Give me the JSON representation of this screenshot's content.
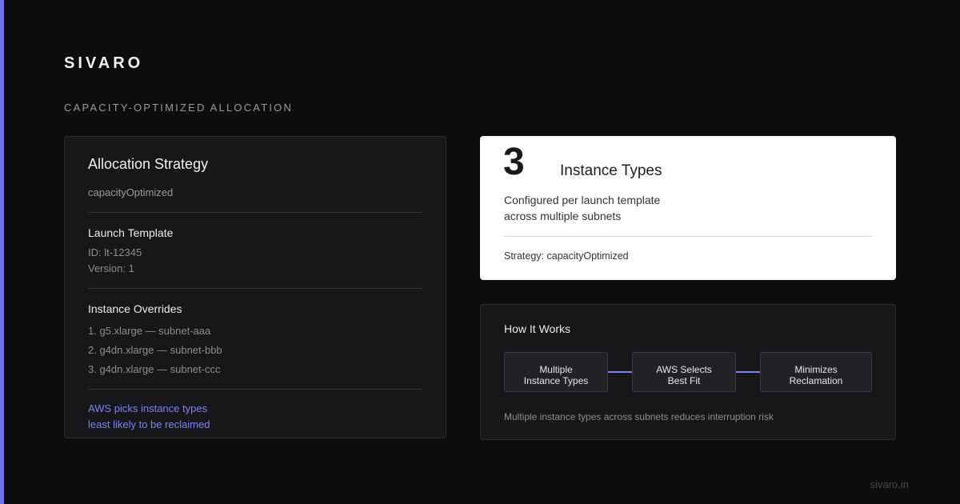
{
  "brand": "SIVARO",
  "subtitle": "CAPACITY-OPTIMIZED ALLOCATION",
  "left_card": {
    "title": "Allocation Strategy",
    "strategy": "capacityOptimized",
    "launch_template": {
      "title": "Launch Template",
      "id": "ID: lt-12345",
      "version": "Version: 1"
    },
    "overrides": {
      "title": "Instance Overrides",
      "items": [
        "1. g5.xlarge — subnet-aaa",
        "2. g4dn.xlarge — subnet-bbb",
        "3. g4dn.xlarge — subnet-ccc"
      ]
    },
    "note_line1": "AWS picks instance types",
    "note_line2": "least likely to be reclaimed"
  },
  "summary_card": {
    "count": "3",
    "count_label": "Instance Types",
    "desc_line1": "Configured per launch template",
    "desc_line2": "across multiple subnets",
    "strategy": "Strategy: capacityOptimized"
  },
  "how_it_works": {
    "title": "How It Works",
    "steps": [
      "Multiple\nInstance Types",
      "AWS Selects\nBest Fit",
      "Minimizes\nReclamation"
    ],
    "caption": "Multiple instance types across subnets reduces interruption risk"
  },
  "footer": "sivaro.in",
  "colors": {
    "accent": "#6b73f0",
    "background": "#0d0d0d",
    "card": "#17171a"
  }
}
